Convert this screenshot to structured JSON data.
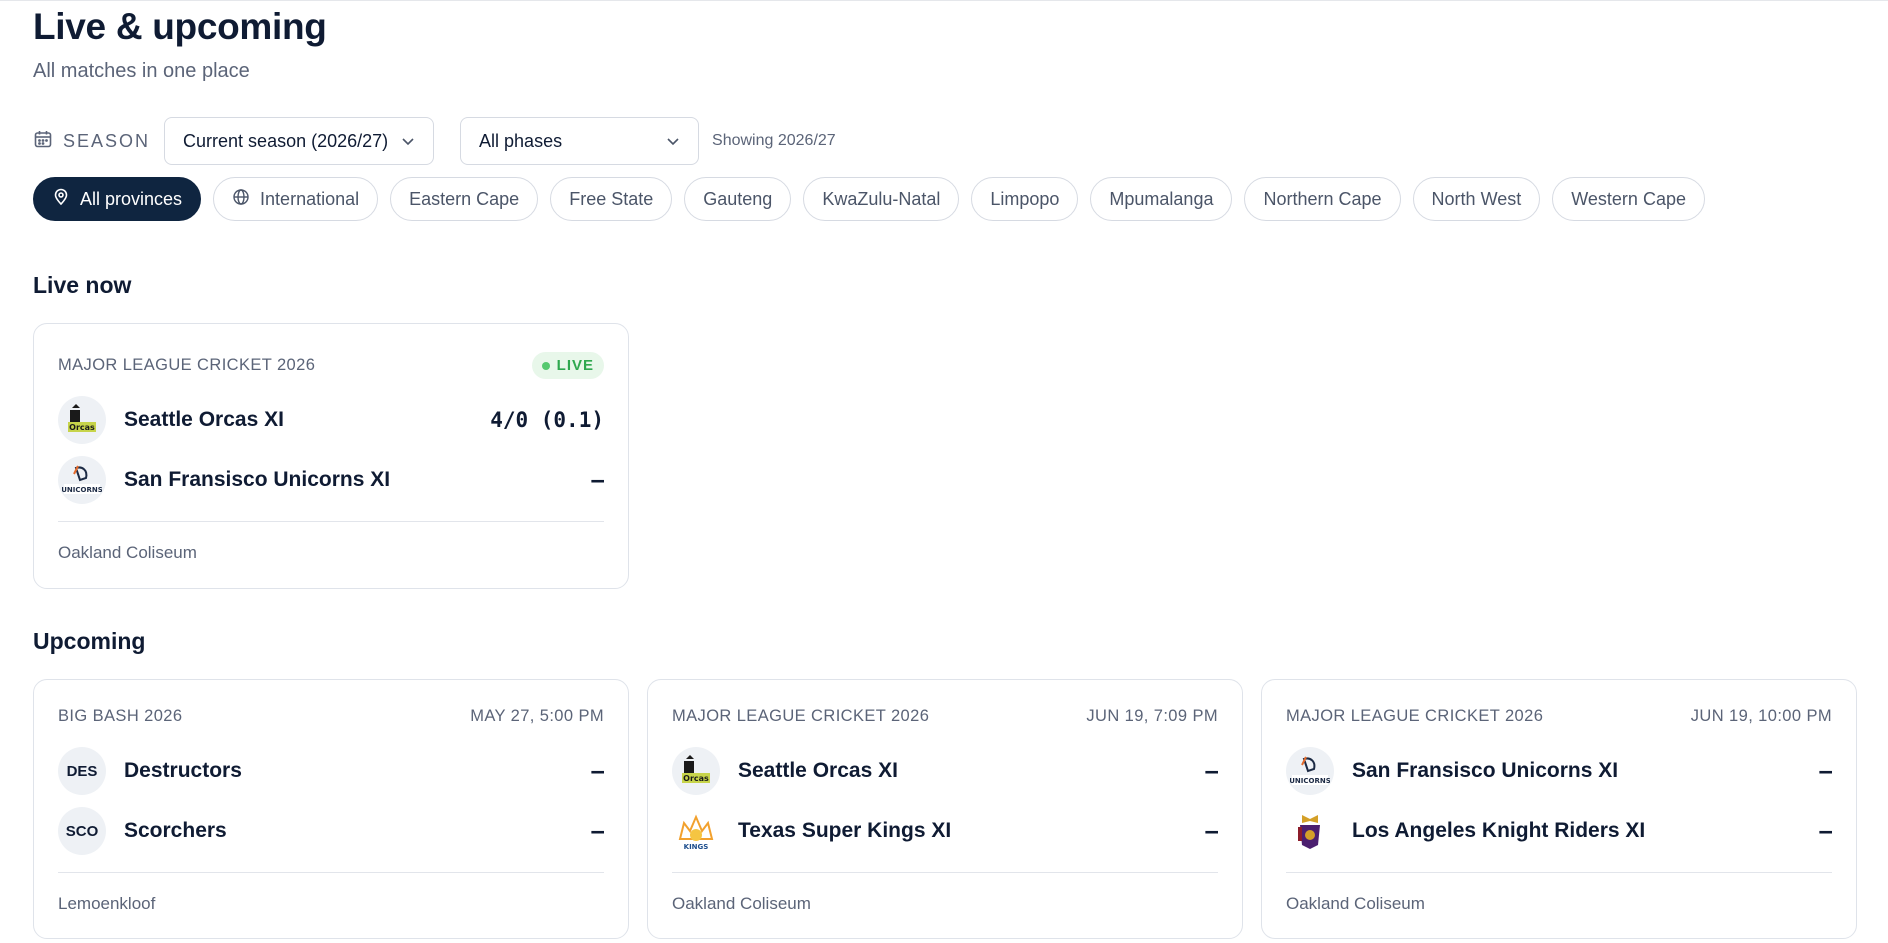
{
  "page": {
    "title": "Live & upcoming",
    "subtitle": "All matches in one place"
  },
  "filters": {
    "season_label": "SEASON",
    "season_value": "Current season (2026/27)",
    "phase_value": "All phases",
    "showing": "Showing 2026/27"
  },
  "provinces": [
    {
      "label": "All provinces",
      "active": true,
      "icon": "map-pin-icon"
    },
    {
      "label": "International",
      "active": false,
      "icon": "globe-icon"
    },
    {
      "label": "Eastern Cape",
      "active": false
    },
    {
      "label": "Free State",
      "active": false
    },
    {
      "label": "Gauteng",
      "active": false
    },
    {
      "label": "KwaZulu-Natal",
      "active": false
    },
    {
      "label": "Limpopo",
      "active": false
    },
    {
      "label": "Mpumalanga",
      "active": false
    },
    {
      "label": "Northern Cape",
      "active": false
    },
    {
      "label": "North West",
      "active": false
    },
    {
      "label": "Western Cape",
      "active": false
    }
  ],
  "live": {
    "section_title": "Live now",
    "matches": [
      {
        "competition": "MAJOR LEAGUE CRICKET 2026",
        "badge": "LIVE",
        "teams": [
          {
            "name": "Seattle Orcas XI",
            "score": "4/0 (0.1)",
            "logo": "orcas-logo"
          },
          {
            "name": "San Fransisco Unicorns XI",
            "score": "–",
            "logo": "unicorns-logo"
          }
        ],
        "venue": "Oakland Coliseum"
      }
    ]
  },
  "upcoming": {
    "section_title": "Upcoming",
    "matches": [
      {
        "competition": "BIG BASH 2026",
        "time": "MAY 27, 5:00 PM",
        "teams": [
          {
            "name": "Destructors",
            "score": "–",
            "abbr": "DES"
          },
          {
            "name": "Scorchers",
            "score": "–",
            "abbr": "SCO"
          }
        ],
        "venue": "Lemoenkloof"
      },
      {
        "competition": "MAJOR LEAGUE CRICKET 2026",
        "time": "JUN 19, 7:09 PM",
        "teams": [
          {
            "name": "Seattle Orcas XI",
            "score": "–",
            "logo": "orcas-logo"
          },
          {
            "name": "Texas Super Kings XI",
            "score": "–",
            "logo": "super-kings-logo"
          }
        ],
        "venue": "Oakland Coliseum"
      },
      {
        "competition": "MAJOR LEAGUE CRICKET 2026",
        "time": "JUN 19, 10:00 PM",
        "teams": [
          {
            "name": "San Fransisco Unicorns XI",
            "score": "–",
            "logo": "unicorns-logo"
          },
          {
            "name": "Los Angeles Knight Riders XI",
            "score": "–",
            "logo": "knight-riders-logo"
          }
        ],
        "venue": "Oakland Coliseum"
      }
    ]
  },
  "colors": {
    "primary": "#0f2540",
    "live_green": "#2fa84f",
    "muted_text": "#5b6478"
  }
}
